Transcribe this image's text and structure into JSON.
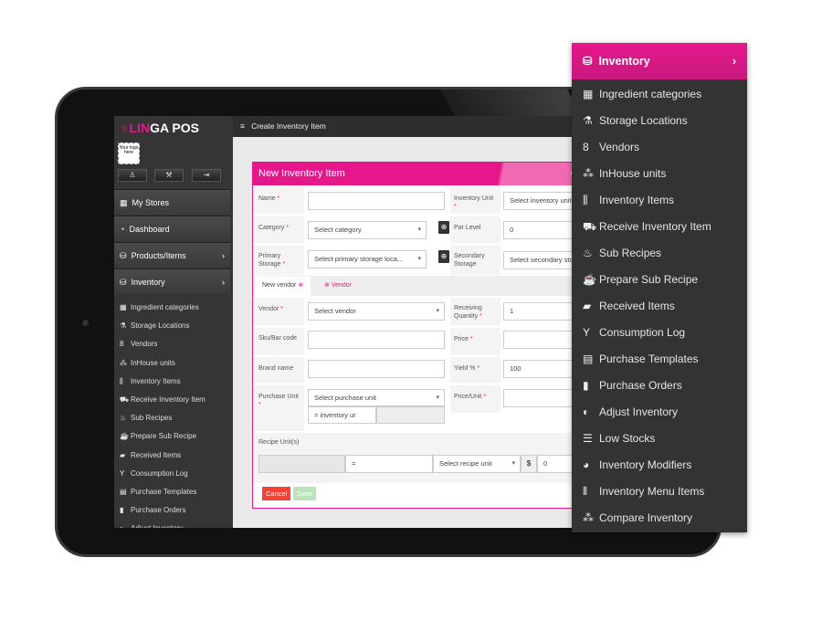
{
  "brand": {
    "name_accent": "LIN",
    "name_rest": "GA POS",
    "logo_placeholder": "Your logo here"
  },
  "topbar": {
    "title": "Create Inventory Item",
    "menu_icon": "hamburger-icon"
  },
  "sidebar": {
    "buttons": [
      {
        "icon": "user-icon",
        "glyph": "♙"
      },
      {
        "icon": "wrench-icon",
        "glyph": "⚒"
      },
      {
        "icon": "logout-icon",
        "glyph": "⇥"
      }
    ],
    "main_items": [
      {
        "label": "My Stores",
        "icon": "store-icon",
        "glyph": "▦"
      },
      {
        "label": "Dashboard",
        "icon": "dashboard-icon",
        "glyph": "◔"
      },
      {
        "label": "Products/Items",
        "icon": "basket-icon",
        "glyph": "⛁",
        "chevron": "›"
      },
      {
        "label": "Inventory",
        "icon": "basket-icon",
        "glyph": "⛁",
        "chevron": "›"
      }
    ],
    "sub_items": [
      {
        "label": "Ingredient categories",
        "glyph": "▦"
      },
      {
        "label": "Storage Locations",
        "glyph": "⚗"
      },
      {
        "label": "Vendors",
        "glyph": "8"
      },
      {
        "label": "InHouse units",
        "glyph": "⁂"
      },
      {
        "label": "Inventory Items",
        "glyph": "⫼"
      },
      {
        "label": "Receive Inventory Item",
        "glyph": "⛟"
      },
      {
        "label": "Sub Recipes",
        "glyph": "♨"
      },
      {
        "label": "Prepare Sub Recipe",
        "glyph": "☕"
      },
      {
        "label": "Received Items",
        "glyph": "▰"
      },
      {
        "label": "Consumption Log",
        "glyph": "Y"
      },
      {
        "label": "Purchase Templates",
        "glyph": "▤"
      },
      {
        "label": "Purchase Orders",
        "glyph": "▮"
      },
      {
        "label": "Adjust Inventory",
        "glyph": "◐"
      }
    ]
  },
  "form": {
    "title": "New Inventory Item",
    "header_right_partial": "O",
    "required_mark": "*",
    "name": {
      "label": "Name",
      "value": ""
    },
    "inventory_unit": {
      "label": "Inventory Unit",
      "placeholder": "Select inventory unit"
    },
    "category": {
      "label": "Category",
      "placeholder": "Select category"
    },
    "par_level": {
      "label": "Par Level",
      "value": "0"
    },
    "primary_storage": {
      "label": "Primary Storage",
      "placeholder": "Select primary storage loca..."
    },
    "secondary_storage": {
      "label": "Secondary Storage",
      "placeholder": "Select secondary storage"
    },
    "tabs": [
      {
        "label": "New vendor",
        "active": true,
        "icon": "close-circle-icon"
      },
      {
        "label": "Vendor",
        "active": false,
        "icon": "plus-circle-icon"
      }
    ],
    "vendor": {
      "label": "Vendor",
      "placeholder": "Select vendor"
    },
    "receiving_quantity": {
      "label": "Receiving Quantity",
      "value": "1"
    },
    "sku": {
      "label": "Sku/Bar code",
      "value": ""
    },
    "price": {
      "label": "Price",
      "value": ""
    },
    "brand_name": {
      "label": "Brand name",
      "value": ""
    },
    "yield": {
      "label": "Yield %",
      "value": "100"
    },
    "purchase_unit": {
      "label": "Purchase Unit",
      "placeholder": "Select purchase unit",
      "equals": "= inventory ur"
    },
    "price_per_unit": {
      "label": "Price/Unit",
      "value": ""
    },
    "recipe_units": {
      "label": "Recipe Unit(s)",
      "equals": "=",
      "placeholder": "Select recipe unit",
      "currency": "$",
      "amount": "0"
    },
    "cancel": "Cancel",
    "save": "Save"
  },
  "menu": {
    "title": "Inventory",
    "icon": "basket-icon",
    "chevron": "›",
    "items": [
      {
        "label": "Ingredient categories",
        "icon": "grid-icon",
        "glyph": "▦"
      },
      {
        "label": "Storage Locations",
        "icon": "flask-icon",
        "glyph": "⚗"
      },
      {
        "label": "Vendors",
        "icon": "vendor-icon",
        "glyph": "8"
      },
      {
        "label": "InHouse units",
        "icon": "cubes-icon",
        "glyph": "⁂"
      },
      {
        "label": "Inventory Items",
        "icon": "utensils-icon",
        "glyph": "⫼"
      },
      {
        "label": "Receive Inventory Item",
        "icon": "cart-icon",
        "glyph": "⛟"
      },
      {
        "label": "Sub Recipes",
        "icon": "recipe-icon",
        "glyph": "♨"
      },
      {
        "label": "Prepare Sub Recipe",
        "icon": "coffee-icon",
        "glyph": "☕"
      },
      {
        "label": "Received Items",
        "icon": "received-icon",
        "glyph": "▰"
      },
      {
        "label": "Consumption Log",
        "icon": "glass-icon",
        "glyph": "Y"
      },
      {
        "label": "Purchase Templates",
        "icon": "document-icon",
        "glyph": "▤"
      },
      {
        "label": "Purchase Orders",
        "icon": "file-icon",
        "glyph": "▮"
      },
      {
        "label": "Adjust Inventory",
        "icon": "adjust-icon",
        "glyph": "◐"
      },
      {
        "label": "Low Stocks",
        "icon": "database-icon",
        "glyph": "☰"
      },
      {
        "label": "Inventory Modifiers",
        "icon": "pie-chart-icon",
        "glyph": "◕"
      },
      {
        "label": "Inventory Menu Items",
        "icon": "cutlery-icon",
        "glyph": "⫴"
      },
      {
        "label": "Compare Inventory",
        "icon": "cubes-icon",
        "glyph": "⁂"
      }
    ]
  },
  "colors": {
    "accent": "#e6168b",
    "cancel": "#f44336",
    "save": "#b9e6b9",
    "sidebar": "#353535"
  }
}
